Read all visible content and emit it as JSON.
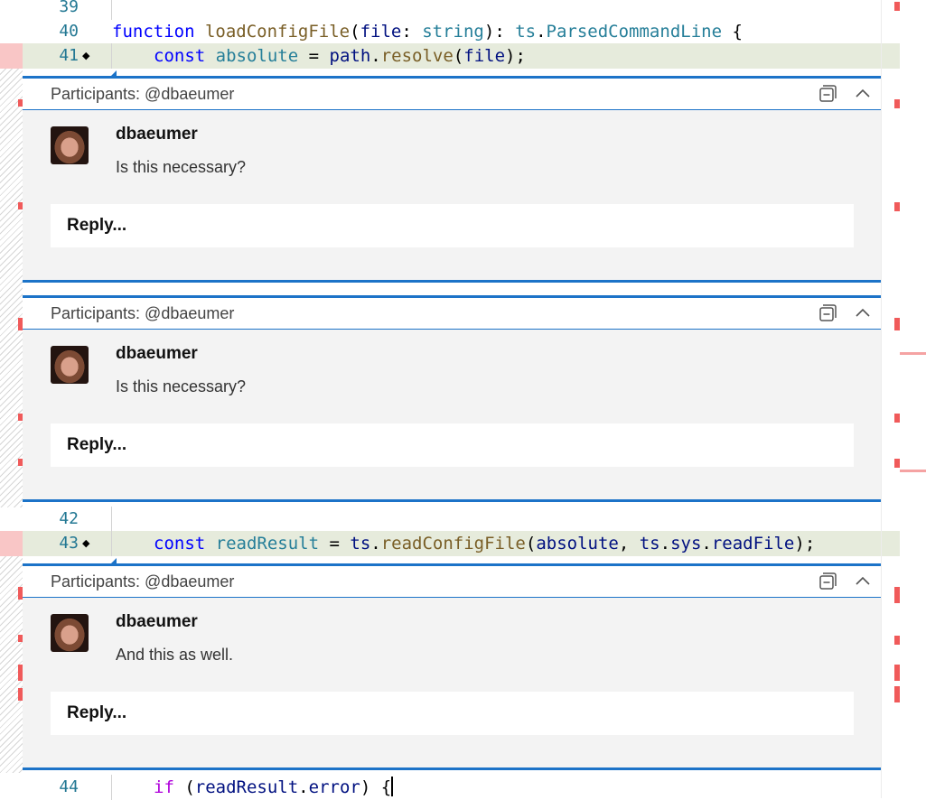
{
  "code_lines": [
    {
      "num": "39"
    },
    {
      "num": "40"
    },
    {
      "num": "41"
    },
    {
      "num": "42"
    },
    {
      "num": "43"
    },
    {
      "num": "44"
    }
  ],
  "code": {
    "line40": {
      "kw": "function",
      "fn": "loadConfigFile",
      "param": "file",
      "type": "string",
      "ns": "ts",
      "rtype": "ParsedCommandLine"
    },
    "line41": {
      "kw": "const",
      "var": "absolute",
      "obj": "path",
      "fn": "resolve",
      "arg": "file"
    },
    "line43": {
      "kw": "const",
      "var": "readResult",
      "ns": "ts",
      "fn": "readConfigFile",
      "arg1": "absolute",
      "ns2": "ts",
      "prop": "sys",
      "fn2": "readFile"
    },
    "line44": {
      "kw": "if",
      "obj": "readResult",
      "prop": "error"
    }
  },
  "threads": [
    {
      "participants": "Participants: @dbaeumer",
      "author": "dbaeumer",
      "body": "Is this necessary?",
      "reply_label": "Reply..."
    },
    {
      "participants": "Participants: @dbaeumer",
      "author": "dbaeumer",
      "body": "Is this necessary?",
      "reply_label": "Reply..."
    },
    {
      "participants": "Participants: @dbaeumer",
      "author": "dbaeumer",
      "body": "And this as well.",
      "reply_label": "Reply..."
    }
  ],
  "icons": {
    "collapse": "collapse-all-icon",
    "chevron": "chevron-up-icon",
    "breakpoint_glyph": "diamond-glyph-icon"
  },
  "colors": {
    "accent": "#1c73c8",
    "deleted": "#f05a5a",
    "line_highlight": "#e6ebdc",
    "thread_bg": "#f3f3f3"
  }
}
